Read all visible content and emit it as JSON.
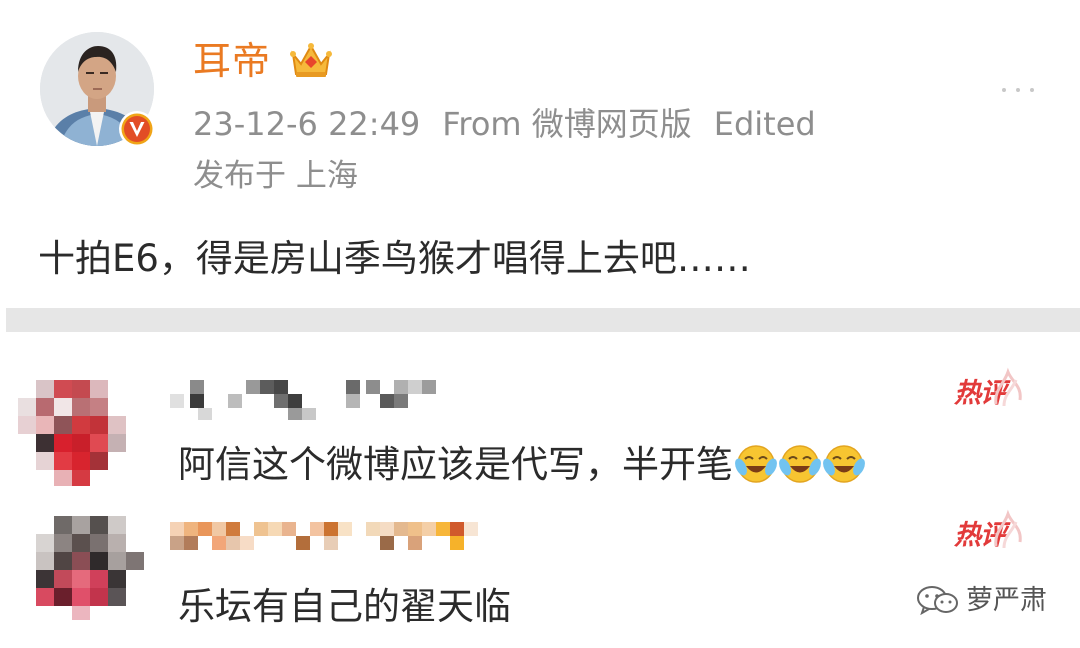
{
  "post": {
    "username": "耳帝",
    "timestamp": "23-12-6 22:49",
    "source": "From 微博网页版",
    "edited": "Edited",
    "location": "发布于 上海",
    "body": "十拍E6，得是房山季鸟猴才唱得上去吧……",
    "username_color": "#ea7a22"
  },
  "comments": [
    {
      "hot_label": "热评",
      "text": "阿信这个微博应该是代写，半开笔",
      "emoji": [
        "laugh-cry",
        "laugh-cry",
        "laugh-cry"
      ]
    },
    {
      "hot_label": "热评",
      "text": "乐坛有自己的翟天临",
      "emoji": []
    }
  ],
  "watermark": {
    "text": "萝严肃",
    "icon": "wechat-icon"
  },
  "colors": {
    "hot": "#e23a3a",
    "meta": "#8e8e8e",
    "text": "#2b2b2b",
    "separator": "#e6e6e6"
  }
}
